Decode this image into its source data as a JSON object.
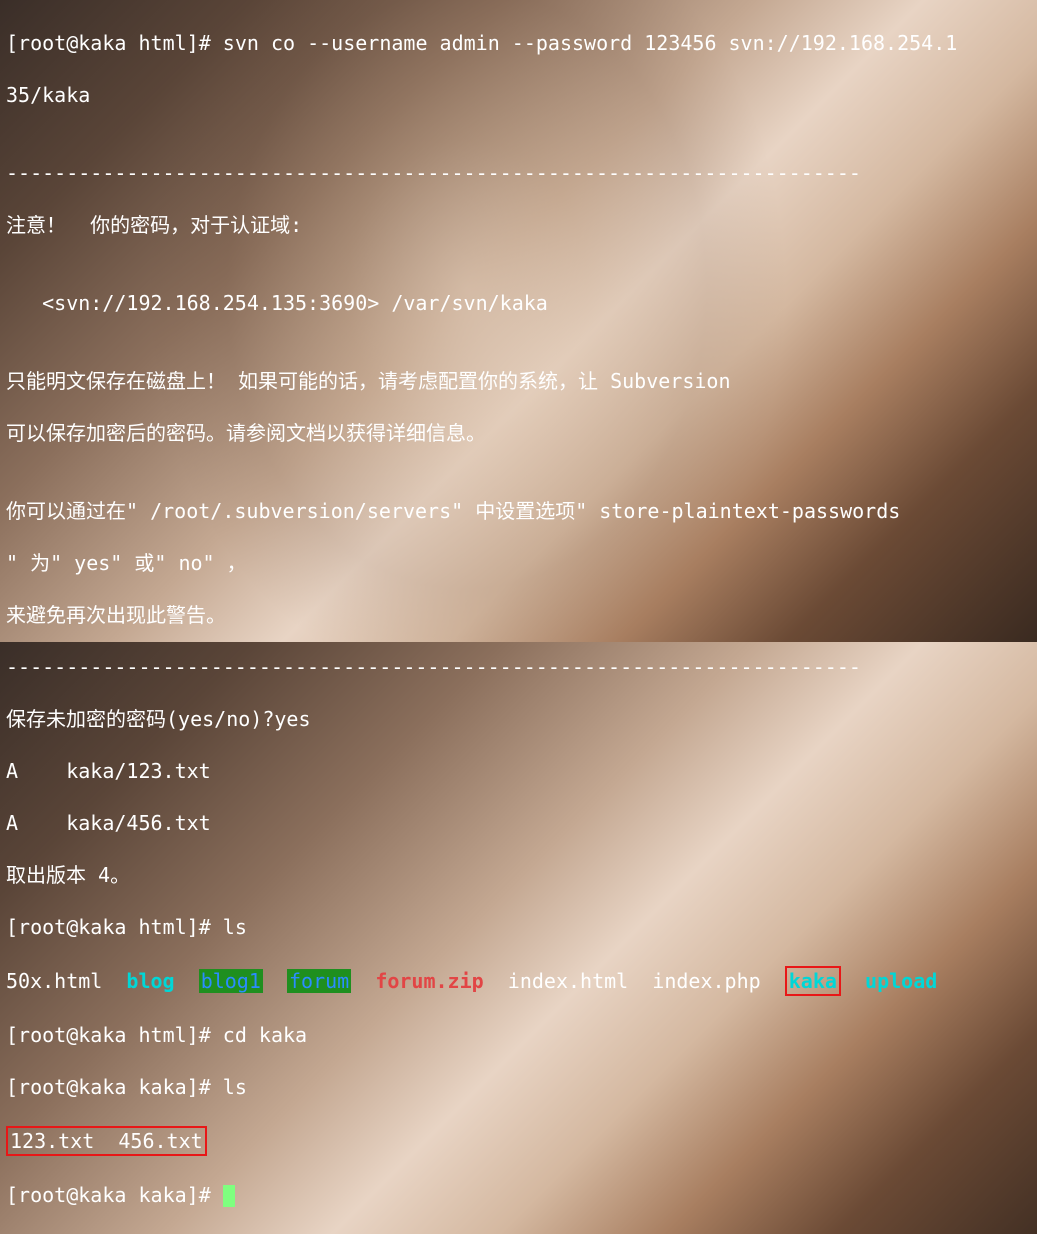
{
  "prompt": {
    "user": "root",
    "host": "kaka",
    "path_html": "html",
    "path_kaka": "kaka",
    "open": "[",
    "at": "@",
    "close": "]#"
  },
  "cmd": {
    "svn_checkout": "svn co --username admin --password 123456 svn://192.168.254.1",
    "svn_checkout_wrap": "35/kaka",
    "ls": "ls",
    "cd_kaka": "cd kaka"
  },
  "output": {
    "blank": "",
    "dashes_long": "-----------------------------------------------------------------------",
    "warn_header": "注意！  你的密码，对于认证域:",
    "realm_line": "   <svn://192.168.254.135:3690> /var/svn/kaka",
    "warn1": "只能明文保存在磁盘上！ 如果可能的话，请考虑配置你的系统，让 Subversion",
    "warn2": "可以保存加密后的密码。请参阅文档以获得详细信息。",
    "warn3": "你可以通过在\" /root/.subversion/servers\" 中设置选项\" store-plaintext-passwords",
    "warn4": "\" 为\" yes\" 或\" no\" ，",
    "warn5": "来避免再次出现此警告。",
    "store_prompt": "保存未加密的密码(yes/no)?yes",
    "added1": "A    kaka/123.txt",
    "added2": "A    kaka/456.txt",
    "checked_out": "取出版本 4。"
  },
  "ls_html": {
    "f1": "50x.html",
    "d_blog": "blog",
    "d_blog1": "blog1",
    "d_forum": "forum",
    "f_forumzip": "forum.zip",
    "f_index_html": "index.html",
    "f_index_php": "index.php",
    "d_kaka": "kaka",
    "d_upload": "upload"
  },
  "ls_kaka": {
    "f1": "123.txt",
    "f2": "456.txt"
  }
}
